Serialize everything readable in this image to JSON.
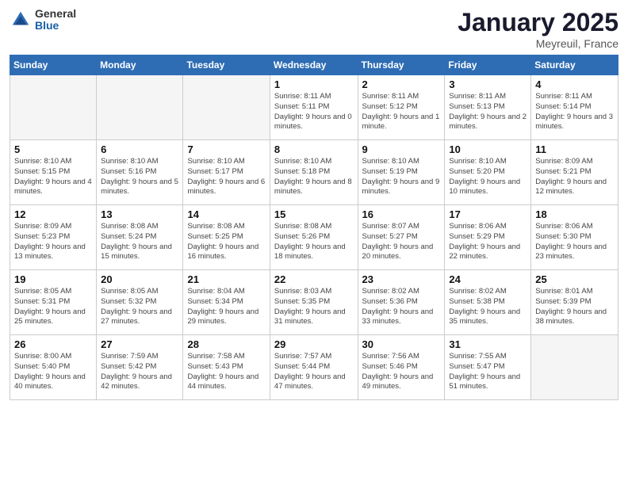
{
  "logo": {
    "general": "General",
    "blue": "Blue"
  },
  "title": "January 2025",
  "subtitle": "Meyreuil, France",
  "weekdays": [
    "Sunday",
    "Monday",
    "Tuesday",
    "Wednesday",
    "Thursday",
    "Friday",
    "Saturday"
  ],
  "weeks": [
    [
      {
        "day": "",
        "sunrise": "",
        "sunset": "",
        "daylight": ""
      },
      {
        "day": "",
        "sunrise": "",
        "sunset": "",
        "daylight": ""
      },
      {
        "day": "",
        "sunrise": "",
        "sunset": "",
        "daylight": ""
      },
      {
        "day": "1",
        "sunrise": "Sunrise: 8:11 AM",
        "sunset": "Sunset: 5:11 PM",
        "daylight": "Daylight: 9 hours and 0 minutes."
      },
      {
        "day": "2",
        "sunrise": "Sunrise: 8:11 AM",
        "sunset": "Sunset: 5:12 PM",
        "daylight": "Daylight: 9 hours and 1 minute."
      },
      {
        "day": "3",
        "sunrise": "Sunrise: 8:11 AM",
        "sunset": "Sunset: 5:13 PM",
        "daylight": "Daylight: 9 hours and 2 minutes."
      },
      {
        "day": "4",
        "sunrise": "Sunrise: 8:11 AM",
        "sunset": "Sunset: 5:14 PM",
        "daylight": "Daylight: 9 hours and 3 minutes."
      }
    ],
    [
      {
        "day": "5",
        "sunrise": "Sunrise: 8:10 AM",
        "sunset": "Sunset: 5:15 PM",
        "daylight": "Daylight: 9 hours and 4 minutes."
      },
      {
        "day": "6",
        "sunrise": "Sunrise: 8:10 AM",
        "sunset": "Sunset: 5:16 PM",
        "daylight": "Daylight: 9 hours and 5 minutes."
      },
      {
        "day": "7",
        "sunrise": "Sunrise: 8:10 AM",
        "sunset": "Sunset: 5:17 PM",
        "daylight": "Daylight: 9 hours and 6 minutes."
      },
      {
        "day": "8",
        "sunrise": "Sunrise: 8:10 AM",
        "sunset": "Sunset: 5:18 PM",
        "daylight": "Daylight: 9 hours and 8 minutes."
      },
      {
        "day": "9",
        "sunrise": "Sunrise: 8:10 AM",
        "sunset": "Sunset: 5:19 PM",
        "daylight": "Daylight: 9 hours and 9 minutes."
      },
      {
        "day": "10",
        "sunrise": "Sunrise: 8:10 AM",
        "sunset": "Sunset: 5:20 PM",
        "daylight": "Daylight: 9 hours and 10 minutes."
      },
      {
        "day": "11",
        "sunrise": "Sunrise: 8:09 AM",
        "sunset": "Sunset: 5:21 PM",
        "daylight": "Daylight: 9 hours and 12 minutes."
      }
    ],
    [
      {
        "day": "12",
        "sunrise": "Sunrise: 8:09 AM",
        "sunset": "Sunset: 5:23 PM",
        "daylight": "Daylight: 9 hours and 13 minutes."
      },
      {
        "day": "13",
        "sunrise": "Sunrise: 8:08 AM",
        "sunset": "Sunset: 5:24 PM",
        "daylight": "Daylight: 9 hours and 15 minutes."
      },
      {
        "day": "14",
        "sunrise": "Sunrise: 8:08 AM",
        "sunset": "Sunset: 5:25 PM",
        "daylight": "Daylight: 9 hours and 16 minutes."
      },
      {
        "day": "15",
        "sunrise": "Sunrise: 8:08 AM",
        "sunset": "Sunset: 5:26 PM",
        "daylight": "Daylight: 9 hours and 18 minutes."
      },
      {
        "day": "16",
        "sunrise": "Sunrise: 8:07 AM",
        "sunset": "Sunset: 5:27 PM",
        "daylight": "Daylight: 9 hours and 20 minutes."
      },
      {
        "day": "17",
        "sunrise": "Sunrise: 8:06 AM",
        "sunset": "Sunset: 5:29 PM",
        "daylight": "Daylight: 9 hours and 22 minutes."
      },
      {
        "day": "18",
        "sunrise": "Sunrise: 8:06 AM",
        "sunset": "Sunset: 5:30 PM",
        "daylight": "Daylight: 9 hours and 23 minutes."
      }
    ],
    [
      {
        "day": "19",
        "sunrise": "Sunrise: 8:05 AM",
        "sunset": "Sunset: 5:31 PM",
        "daylight": "Daylight: 9 hours and 25 minutes."
      },
      {
        "day": "20",
        "sunrise": "Sunrise: 8:05 AM",
        "sunset": "Sunset: 5:32 PM",
        "daylight": "Daylight: 9 hours and 27 minutes."
      },
      {
        "day": "21",
        "sunrise": "Sunrise: 8:04 AM",
        "sunset": "Sunset: 5:34 PM",
        "daylight": "Daylight: 9 hours and 29 minutes."
      },
      {
        "day": "22",
        "sunrise": "Sunrise: 8:03 AM",
        "sunset": "Sunset: 5:35 PM",
        "daylight": "Daylight: 9 hours and 31 minutes."
      },
      {
        "day": "23",
        "sunrise": "Sunrise: 8:02 AM",
        "sunset": "Sunset: 5:36 PM",
        "daylight": "Daylight: 9 hours and 33 minutes."
      },
      {
        "day": "24",
        "sunrise": "Sunrise: 8:02 AM",
        "sunset": "Sunset: 5:38 PM",
        "daylight": "Daylight: 9 hours and 35 minutes."
      },
      {
        "day": "25",
        "sunrise": "Sunrise: 8:01 AM",
        "sunset": "Sunset: 5:39 PM",
        "daylight": "Daylight: 9 hours and 38 minutes."
      }
    ],
    [
      {
        "day": "26",
        "sunrise": "Sunrise: 8:00 AM",
        "sunset": "Sunset: 5:40 PM",
        "daylight": "Daylight: 9 hours and 40 minutes."
      },
      {
        "day": "27",
        "sunrise": "Sunrise: 7:59 AM",
        "sunset": "Sunset: 5:42 PM",
        "daylight": "Daylight: 9 hours and 42 minutes."
      },
      {
        "day": "28",
        "sunrise": "Sunrise: 7:58 AM",
        "sunset": "Sunset: 5:43 PM",
        "daylight": "Daylight: 9 hours and 44 minutes."
      },
      {
        "day": "29",
        "sunrise": "Sunrise: 7:57 AM",
        "sunset": "Sunset: 5:44 PM",
        "daylight": "Daylight: 9 hours and 47 minutes."
      },
      {
        "day": "30",
        "sunrise": "Sunrise: 7:56 AM",
        "sunset": "Sunset: 5:46 PM",
        "daylight": "Daylight: 9 hours and 49 minutes."
      },
      {
        "day": "31",
        "sunrise": "Sunrise: 7:55 AM",
        "sunset": "Sunset: 5:47 PM",
        "daylight": "Daylight: 9 hours and 51 minutes."
      },
      {
        "day": "",
        "sunrise": "",
        "sunset": "",
        "daylight": ""
      }
    ]
  ]
}
